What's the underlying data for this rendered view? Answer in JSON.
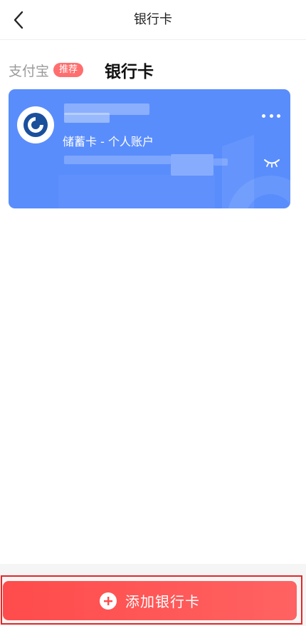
{
  "nav": {
    "title": "银行卡",
    "back_icon": "chevron-left-icon"
  },
  "tabs": {
    "alipay_label": "支付宝",
    "alipay_badge": "推荐",
    "bank_label": "银行卡"
  },
  "card": {
    "type_label": "储蓄卡 - 个人账户",
    "logo_icon": "bank-logo-icon",
    "more_icon": "more-dots-icon",
    "eye_icon": "eye-closed-icon",
    "color": "#5a8dfc"
  },
  "footer": {
    "add_label": "添加银行卡",
    "add_icon": "plus-circle-icon",
    "color": "#ff4b4b"
  }
}
